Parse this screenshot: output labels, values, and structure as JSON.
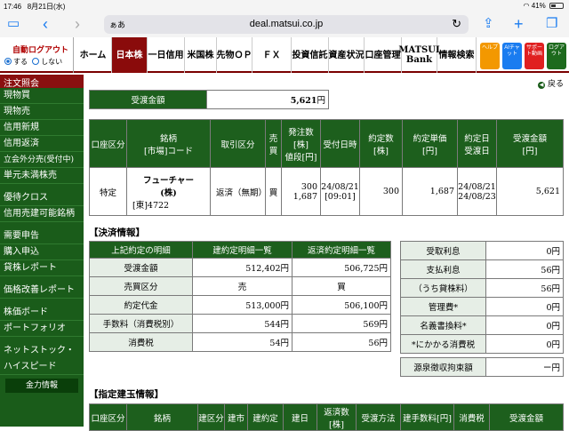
{
  "status": {
    "time": "17:46",
    "date": "8月21日(水)",
    "signal": "wifi",
    "battery": "41%"
  },
  "browser": {
    "aa": "ぁあ",
    "url": "deal.matsui.co.jp",
    "icons": [
      "sidebar-icon",
      "back-icon",
      "forward-icon",
      "reload-icon",
      "share-icon",
      "plus-icon",
      "tabs-icon"
    ]
  },
  "nav": {
    "login": {
      "title": "自動ログアウト",
      "on": "する",
      "off": "しない"
    },
    "tabs": [
      "ホーム",
      "日本株",
      "一日信用",
      "米国株",
      "先物ＯＰ",
      "ＦＸ",
      "投資信託",
      "資産状況",
      "口座管理",
      "MATSUI Bank",
      "情報検索"
    ],
    "icons": [
      {
        "label": "ヘルプ",
        "color": "#f39800"
      },
      {
        "label": "AIチャット",
        "color": "#1a7cf0"
      },
      {
        "label": "サポート動画",
        "color": "#e02020"
      },
      {
        "label": "ログアウト",
        "color": "#1d6a1d"
      }
    ]
  },
  "sidebar": {
    "header": "注文照会",
    "group1": [
      "現物買",
      "現物売",
      "信用新規",
      "信用返済",
      "立会外分売(受付中)",
      "単元未満株売"
    ],
    "group2": [
      "優待クロス",
      "信用売建可能銘柄"
    ],
    "group3": [
      "需要申告",
      "購入申込",
      "貸株レポート"
    ],
    "group4": [
      "価格改善レポート"
    ],
    "group5": [
      "株価ボード",
      "ポートフォリオ"
    ],
    "group6": [
      "ネットストック・",
      "ハイスピード"
    ],
    "button": "金力情報"
  },
  "main": {
    "back": "戻る",
    "delivery": {
      "label": "受渡金額",
      "value": "5,621",
      "unit": "円"
    },
    "order_headers": [
      "口座区分",
      "銘柄\n[市場]コード",
      "取引区分",
      "売買",
      "発注数\n[株]\n値段[円]",
      "受付日時",
      "約定数\n[株]",
      "約定単価\n[円]",
      "約定日\n受渡日",
      "受渡金額\n[円]"
    ],
    "order_row": {
      "account": "特定",
      "name": "フューチャー\n(株)",
      "code": "[東]4722",
      "type": "返済（無期）",
      "side": "買",
      "qty": "300",
      "price": "1,687",
      "date": "24/08/21",
      "time": "[09:01]",
      "exec_qty": "300",
      "exec_price": "1,687",
      "trade_date": "24/08/21",
      "settle_date": "24/08/23",
      "amount": "5,621"
    },
    "settlement": {
      "title": "【決済情報】",
      "headers": [
        "上記約定の明細",
        "建約定明細一覧",
        "返済約定明細一覧"
      ],
      "rows": [
        {
          "label": "受渡金額",
          "a": "512,402円",
          "b": "506,725円"
        },
        {
          "label": "売買区分",
          "a": "売",
          "b": "買"
        },
        {
          "label": "約定代金",
          "a": "513,000円",
          "b": "506,100円"
        },
        {
          "label": "手数料（消費税別）",
          "a": "544円",
          "b": "569円"
        },
        {
          "label": "消費税",
          "a": "54円",
          "b": "56円"
        }
      ],
      "right": [
        {
          "label": "受取利息",
          "value": "0円"
        },
        {
          "label": "支払利息",
          "value": "56円"
        },
        {
          "label": "（うち貸株料）",
          "value": "56円"
        },
        {
          "label": "管理費*",
          "value": "0円"
        },
        {
          "label": "名義書換料*",
          "value": "0円"
        },
        {
          "label": "*にかかる消費税",
          "value": "0円"
        }
      ],
      "withholding": {
        "label": "源泉徴収拘束額",
        "value": "ー円"
      }
    },
    "designated": {
      "title": "【指定建玉情報】",
      "headers": [
        "口座区分",
        "銘柄",
        "建区分",
        "建市",
        "建約定",
        "建日",
        "返済数[株]",
        "受渡方法",
        "建手数料[円]",
        "消費税",
        "受渡金額"
      ]
    }
  }
}
